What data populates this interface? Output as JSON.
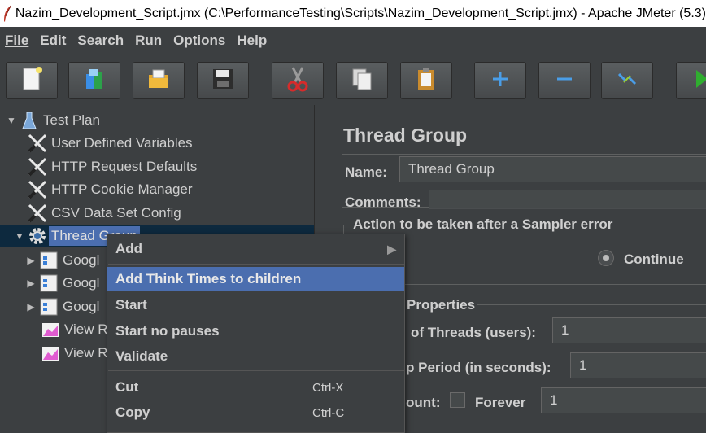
{
  "window": {
    "title": "Nazim_Development_Script.jmx (C:\\PerformanceTesting\\Scripts\\Nazim_Development_Script.jmx) - Apache JMeter (5.3)"
  },
  "menu": [
    {
      "label": "File"
    },
    {
      "label": "Edit"
    },
    {
      "label": "Search"
    },
    {
      "label": "Run"
    },
    {
      "label": "Options"
    },
    {
      "label": "Help"
    }
  ],
  "toolbar": {
    "buttons": [
      {
        "icon": "new-document-icon"
      },
      {
        "icon": "templates-icon"
      },
      {
        "icon": "open-folder-icon"
      },
      {
        "icon": "save-icon"
      },
      {
        "icon": "cut-icon"
      },
      {
        "icon": "copy-icon"
      },
      {
        "icon": "paste-icon"
      },
      {
        "icon": "expand-icon"
      },
      {
        "icon": "collapse-icon"
      },
      {
        "icon": "toggle-icon"
      },
      {
        "icon": "start-icon"
      }
    ]
  },
  "tree": {
    "items": [
      {
        "label": "Test Plan",
        "icon": "test-plan-flask-icon"
      },
      {
        "label": "User Defined Variables",
        "icon": "config-wrench-icon"
      },
      {
        "label": "HTTP Request Defaults",
        "icon": "config-wrench-icon"
      },
      {
        "label": "HTTP Cookie Manager",
        "icon": "config-wrench-icon"
      },
      {
        "label": "CSV Data Set Config",
        "icon": "config-wrench-icon"
      },
      {
        "label": "Thread Group",
        "icon": "gear-icon"
      },
      {
        "label": "Googl",
        "icon": "sampler-icon"
      },
      {
        "label": "Googl",
        "icon": "sampler-icon"
      },
      {
        "label": "Googl",
        "icon": "sampler-icon"
      },
      {
        "label": "View R",
        "icon": "listener-graph-icon"
      },
      {
        "label": "View R",
        "icon": "listener-graph-icon"
      }
    ]
  },
  "panel": {
    "title": "Thread Group",
    "name_label": "Name:",
    "name_value": "Thread Group",
    "comments_label": "Comments:",
    "sampler_error_group": "Action to be taken after a Sampler error",
    "continue_label": "Continue",
    "properties_label": "Properties",
    "threads_label": "of Threads (users):",
    "threads_value": "1",
    "ramp_label": "p Period (in seconds):",
    "ramp_value": "1",
    "loop_label": "ount:",
    "forever_label": "Forever",
    "loop_value": "1"
  },
  "context_menu": {
    "items": [
      {
        "label": "Add",
        "submenu": "▶"
      },
      {
        "label": "Add Think Times to children"
      },
      {
        "label": "Start"
      },
      {
        "label": "Start no pauses"
      },
      {
        "label": "Validate"
      },
      {
        "label": "Cut",
        "shortcut": "Ctrl-X"
      },
      {
        "label": "Copy",
        "shortcut": "Ctrl-C"
      }
    ]
  },
  "colors": {
    "background": "#3c3f41",
    "selection": "#4b6eaf",
    "text": "#cfcfcf"
  }
}
